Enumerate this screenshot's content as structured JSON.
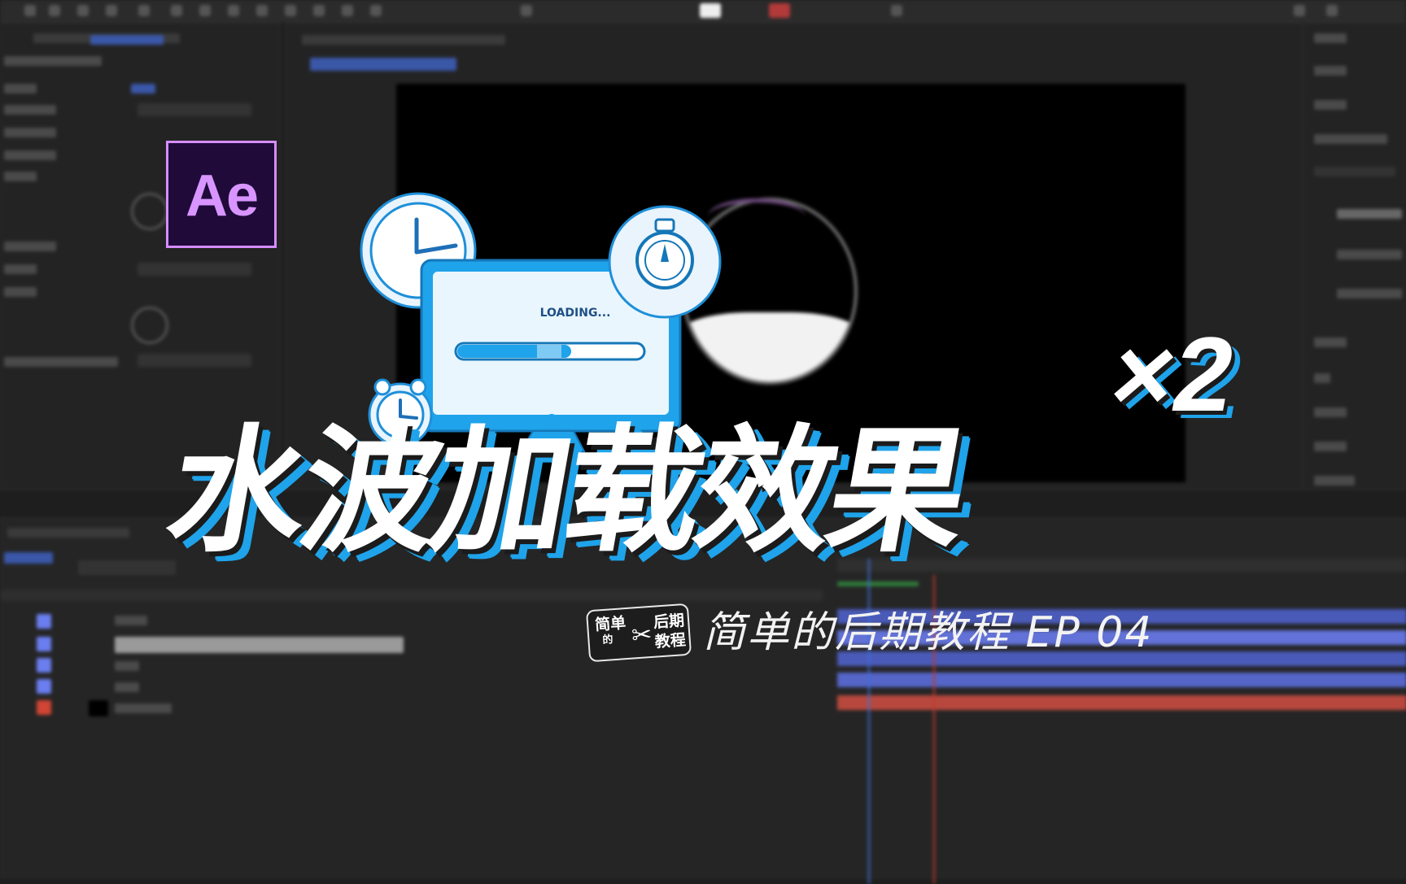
{
  "cover": {
    "title": "水波加载效果",
    "multiplier": "×2",
    "subtitle": "简单的后期教程 EP 04",
    "app_logo_text": "Ae",
    "loading_text": "LOADING...",
    "badge": {
      "line1": "简单",
      "line2": "的",
      "line3": "后期",
      "line4": "教程"
    }
  },
  "colors": {
    "accent": "#1fa3ea",
    "ae_purple": "#d58dff",
    "ae_bg": "#1f0a3a",
    "text": "#ffffff"
  },
  "icons": [
    "clock-icon",
    "stopwatch-icon",
    "monitor-icon",
    "alarm-clock-icon",
    "scissors-icon"
  ]
}
